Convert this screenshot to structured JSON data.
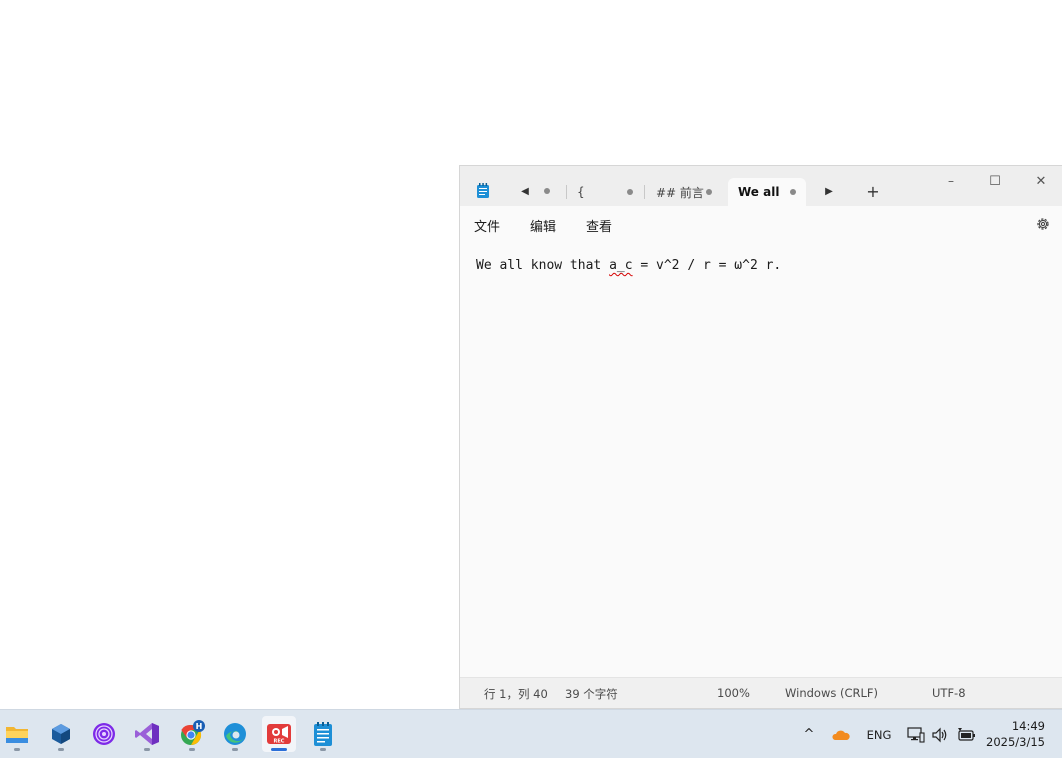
{
  "notepad": {
    "tabs": [
      {
        "title": "{"
      },
      {
        "title": "## 前言"
      },
      {
        "title": "We all"
      }
    ],
    "new_tab_label": "+",
    "window_controls": {
      "minimize": "–",
      "maximize": "☐",
      "close": "✕"
    },
    "menu": {
      "file": "文件",
      "edit": "编辑",
      "view": "查看"
    },
    "editor": {
      "before_error": "We all know that ",
      "misspelled": "a_c",
      "after_error": " = v^2 / r = ω^2 r."
    },
    "status": {
      "position": "行 1，列 40",
      "char_count": "39 个字符",
      "zoom": "100%",
      "line_ending": "Windows (CRLF)",
      "encoding": "UTF-8"
    }
  },
  "taskbar": {
    "apps": [
      {
        "name": "file-explorer-icon"
      },
      {
        "name": "virtualbox-icon"
      },
      {
        "name": "tor-browser-icon"
      },
      {
        "name": "visual-studio-icon"
      },
      {
        "name": "chrome-icon",
        "badge": "H"
      },
      {
        "name": "edge-icon"
      },
      {
        "name": "screen-recorder-icon",
        "badge": "REC"
      },
      {
        "name": "notepad-icon"
      }
    ],
    "tray": {
      "chevron": "^",
      "language": "ENG"
    },
    "clock": {
      "time": "14:49",
      "date": "2025/3/15"
    }
  },
  "colors": {
    "accent": "#2b6fd8",
    "taskbar_bg": "#dde6ef",
    "spell_error": "#d40000"
  }
}
